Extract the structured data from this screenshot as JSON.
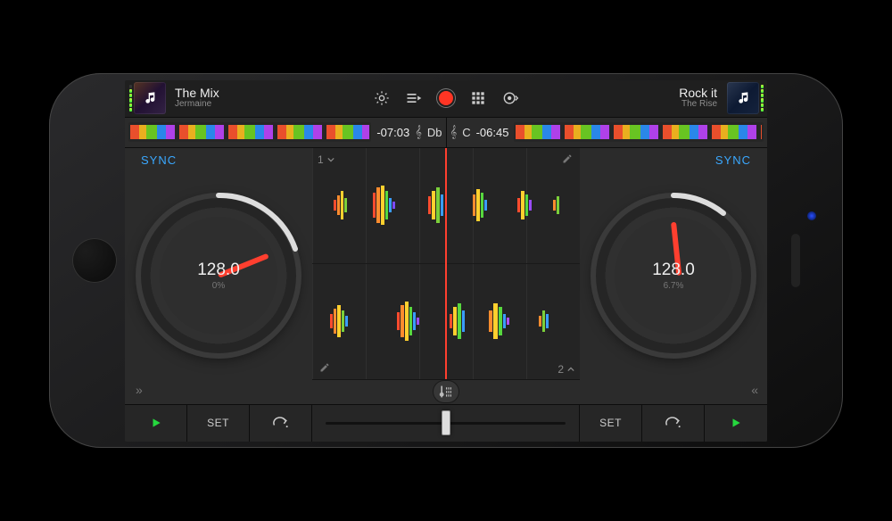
{
  "decks": {
    "left": {
      "title": "The Mix",
      "artist": "Jermaine",
      "time": "-07:03",
      "key": "Db",
      "bpm": "128.0",
      "pitch_pct": "0%",
      "sync_label": "SYNC",
      "deck_number": "1"
    },
    "right": {
      "title": "Rock it",
      "artist": "The Rise",
      "time": "-06:45",
      "key": "C",
      "bpm": "128.0",
      "pitch_pct": "6.7%",
      "sync_label": "SYNC",
      "deck_number": "2"
    }
  },
  "transport": {
    "play": "▶",
    "set": "SET",
    "loop": "↷"
  },
  "expand": {
    "left": "»",
    "right": "«"
  },
  "clef": "𝄞"
}
